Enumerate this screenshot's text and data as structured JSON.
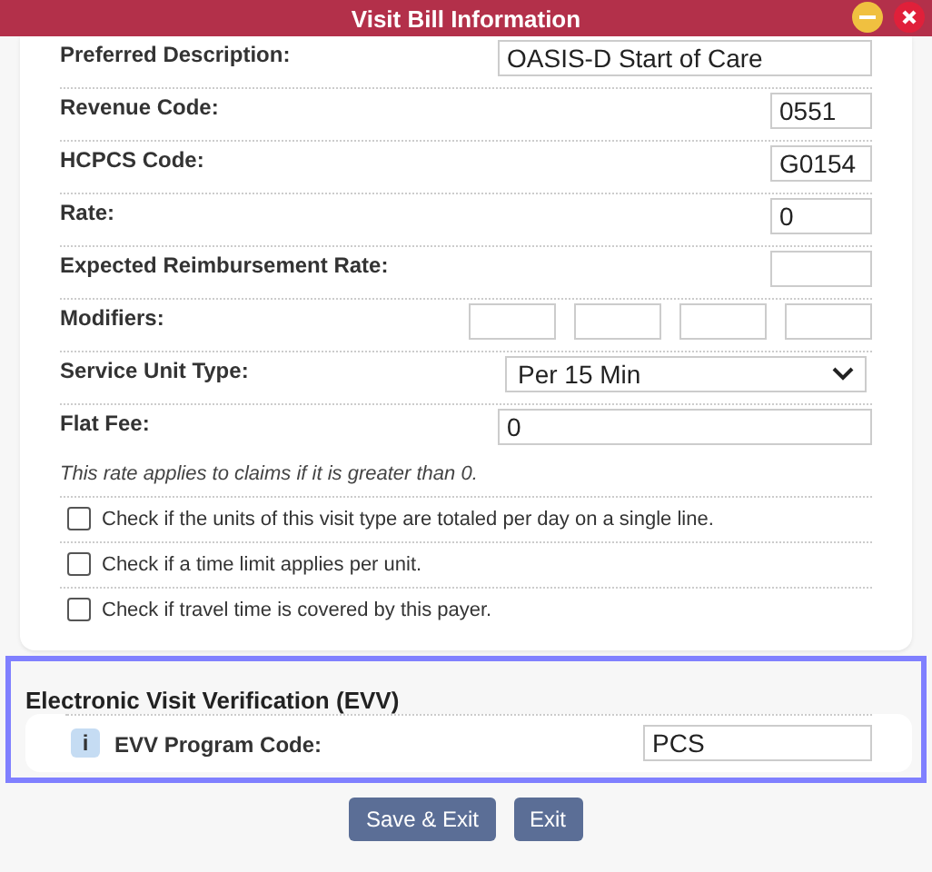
{
  "window": {
    "title": "Visit Bill Information"
  },
  "fields": [
    {
      "kind": "wide",
      "label": "Preferred Description:",
      "value": "OASIS-D Start of Care"
    },
    {
      "kind": "short",
      "label": "Revenue Code:",
      "value": "0551"
    },
    {
      "kind": "short",
      "label": "HCPCS Code:",
      "value": "G0154"
    },
    {
      "kind": "short",
      "label": "Rate:",
      "value": "0"
    },
    {
      "kind": "short",
      "label": "Expected Reimbursement Rate:"
    },
    {
      "kind": "modifiers",
      "label": "Modifiers:"
    },
    {
      "kind": "select",
      "label": "Service Unit Type:",
      "value": "Per 15 Min"
    },
    {
      "kind": "wide",
      "label": "Flat Fee:",
      "value": "0",
      "note": "This rate applies to claims if it is greater than 0."
    }
  ],
  "checkboxes": [
    {
      "label": "Check if the units of this visit type are totaled per day on a single line.",
      "checked": false
    },
    {
      "label": "Check if a time limit applies per unit.",
      "checked": false
    },
    {
      "label": "Check if travel time is covered by this payer.",
      "checked": false
    }
  ],
  "evv": {
    "title": "Electronic Visit Verification (EVV)",
    "info": "i",
    "label": "EVV Program Code:",
    "value": "PCS"
  },
  "buttons": [
    "Save & Exit",
    "Exit"
  ]
}
